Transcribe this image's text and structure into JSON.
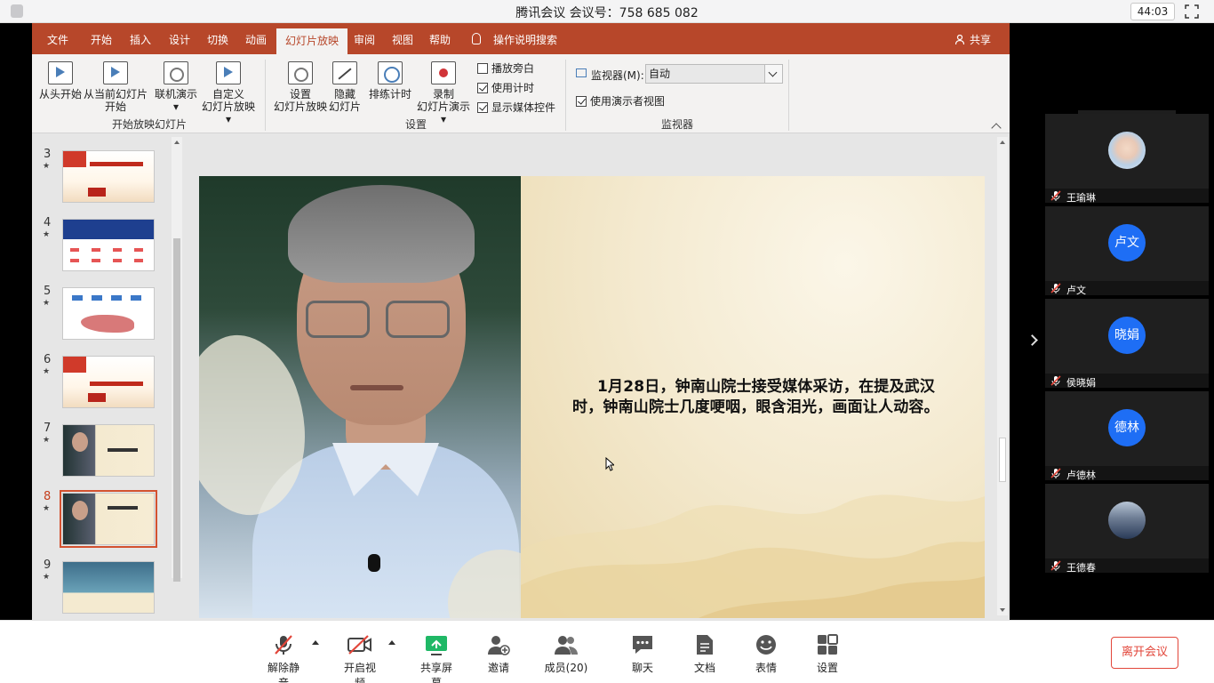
{
  "meeting": {
    "title": "腾讯会议 会议号：758 685 082",
    "timer": "44:03"
  },
  "ppt": {
    "tabs": [
      "文件",
      "开始",
      "插入",
      "设计",
      "切换",
      "动画",
      "幻灯片放映",
      "审阅",
      "视图",
      "帮助",
      "操作说明搜索"
    ],
    "active_tab": "幻灯片放映",
    "share_label": "共享",
    "ribbon": {
      "from_beginning": "从头开始",
      "from_current_1": "从当前幻灯片",
      "from_current_2": "开始",
      "online_1": "联机演示",
      "online_2": "▾",
      "custom_1": "自定义",
      "custom_2": "幻灯片放映 ▾",
      "group_start": "开始放映幻灯片",
      "setup_1": "设置",
      "setup_2": "幻灯片放映",
      "hide_1": "隐藏",
      "hide_2": "幻灯片",
      "rehearse": "排练计时",
      "record_1": "录制",
      "record_2": "幻灯片演示 ▾",
      "chk_narration": "播放旁白",
      "chk_timing": "使用计时",
      "chk_media": "显示媒体控件",
      "group_setup": "设置",
      "monitor_label": "监视器(M):",
      "monitor_value": "自动",
      "chk_presenter": "使用演示者视图",
      "group_monitor": "监视器"
    },
    "checkbox_states": {
      "narration": false,
      "timing": true,
      "media": true,
      "presenter": true
    },
    "slides": [
      {
        "num": "3",
        "star": "★",
        "type": "red"
      },
      {
        "num": "4",
        "star": "★",
        "type": "blue"
      },
      {
        "num": "5",
        "star": "★",
        "type": "map"
      },
      {
        "num": "6",
        "star": "★",
        "type": "red"
      },
      {
        "num": "7",
        "star": "★",
        "type": "photo"
      },
      {
        "num": "8",
        "star": "★",
        "type": "photo",
        "active": true
      },
      {
        "num": "9",
        "star": "★",
        "type": "op"
      }
    ],
    "current_slide_text": "1月28日，钟南山院士接受媒体采访，在提及武汉时，钟南山院士几度哽咽，眼含泪光，画面让人动容。"
  },
  "participants": [
    {
      "name": "王瑜琳",
      "avatar_text": "",
      "avatar_style": "photo-baby"
    },
    {
      "name": "卢文",
      "avatar_text": "卢文",
      "avatar_style": "blue"
    },
    {
      "name": "侯晓娟",
      "avatar_text": "晓娟",
      "avatar_style": "blue"
    },
    {
      "name": "卢德林",
      "avatar_text": "德林",
      "avatar_style": "blue"
    },
    {
      "name": "王德春",
      "avatar_text": "",
      "avatar_style": "photo-person"
    }
  ],
  "toolbar": {
    "unmute": "解除静音",
    "start_video": "开启视频",
    "share_screen": "共享屏幕",
    "invite": "邀请",
    "members": "成员(20)",
    "chat": "聊天",
    "docs": "文档",
    "reactions": "表情",
    "settings": "设置",
    "leave": "离开会议"
  },
  "colors": {
    "ppt_accent": "#b7472a",
    "tencent_blue": "#1e6ef5",
    "share_green": "#1fb866",
    "leave_red": "#e2463a"
  }
}
